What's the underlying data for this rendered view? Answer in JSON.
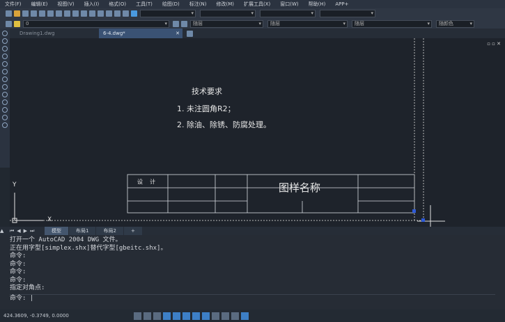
{
  "menu": [
    "文件(F)",
    "编辑(E)",
    "视图(V)",
    "插入(I)",
    "格式(O)",
    "工具(T)",
    "绘图(D)",
    "标注(N)",
    "修改(M)",
    "扩展工具(X)",
    "窗口(W)",
    "帮助(H)",
    "APP+"
  ],
  "toolbar": {
    "layer_value": "0",
    "color_value": "随层",
    "linetype_value": "随层",
    "lineweight_value": "随层",
    "plotstyle_value": "随颜色"
  },
  "doc_tabs": [
    {
      "label": "Drawing1.dwg"
    },
    {
      "label": "6-4.dwg*"
    }
  ],
  "drawing": {
    "title": "技术要求",
    "req1": "1.  未注圆角R2；",
    "req2": "2.  除油、除锈、防腐处理。",
    "design_label": "设    计",
    "name_label": "图样名称",
    "axis_y": "Y",
    "axis_x": "X"
  },
  "layout_tabs": [
    "模型",
    "布局1",
    "布局2",
    "+"
  ],
  "command_history": [
    "打开一个 AutoCAD 2004 DWG 文件。",
    "正在用字型[simplex.shx]替代字型[gbeitc.shx]。",
    "命令:",
    "命令:",
    "命令:",
    "命令:",
    "指定对角点:"
  ],
  "command_prompt": "命令:",
  "status": {
    "coords": "424.3609, -0.3749, 0.0000"
  }
}
